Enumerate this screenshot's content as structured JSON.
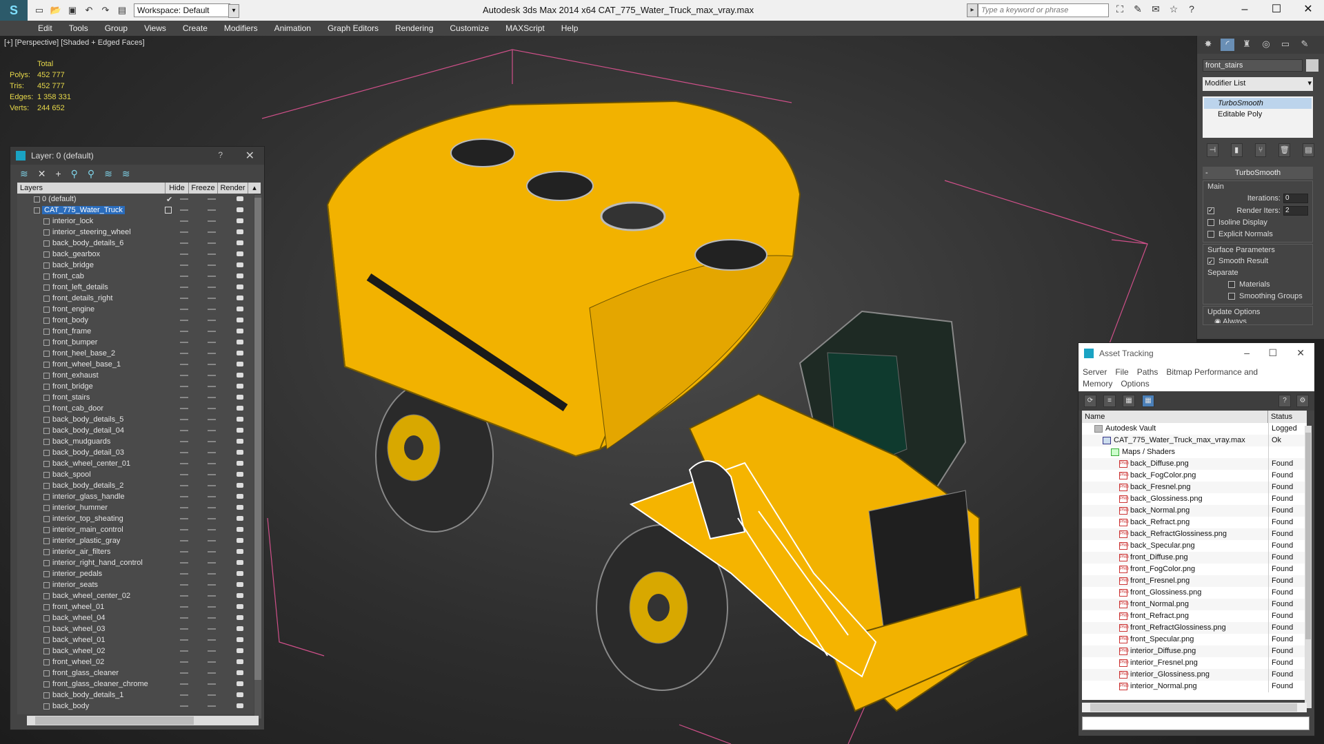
{
  "window": {
    "title": "Autodesk 3ds Max 2014 x64      CAT_775_Water_Truck_max_vray.max",
    "workspace": "Workspace: Default",
    "search_placeholder": "Type a keyword or phrase"
  },
  "menu": [
    "Edit",
    "Tools",
    "Group",
    "Views",
    "Create",
    "Modifiers",
    "Animation",
    "Graph Editors",
    "Rendering",
    "Customize",
    "MAXScript",
    "Help"
  ],
  "viewport": {
    "label": "[+] [Perspective] [Shaded + Edged Faces]",
    "stats": {
      "header": "Total",
      "rows": [
        {
          "k": "Polys:",
          "v": "452 777"
        },
        {
          "k": "Tris:",
          "v": "452 777"
        },
        {
          "k": "Edges:",
          "v": "1 358 331"
        },
        {
          "k": "Verts:",
          "v": "244 652"
        }
      ]
    },
    "accent_color": "#f5b400"
  },
  "layer_panel": {
    "title": "Layer: 0 (default)",
    "help": "?",
    "columns": [
      "Layers",
      "Hide",
      "Freeze",
      "Render"
    ],
    "layers": [
      {
        "name": "0 (default)",
        "level": 0,
        "checked": true
      },
      {
        "name": "CAT_775_Water_Truck",
        "level": 0,
        "selected": true
      },
      {
        "name": "interior_lock",
        "level": 1
      },
      {
        "name": "interior_steering_wheel",
        "level": 1
      },
      {
        "name": "back_body_details_6",
        "level": 1
      },
      {
        "name": "back_gearbox",
        "level": 1
      },
      {
        "name": "back_bridge",
        "level": 1
      },
      {
        "name": "front_cab",
        "level": 1
      },
      {
        "name": "front_left_details",
        "level": 1
      },
      {
        "name": "front_details_right",
        "level": 1
      },
      {
        "name": "front_engine",
        "level": 1
      },
      {
        "name": "front_body",
        "level": 1
      },
      {
        "name": "front_frame",
        "level": 1
      },
      {
        "name": "front_bumper",
        "level": 1
      },
      {
        "name": "front_heel_base_2",
        "level": 1
      },
      {
        "name": "front_wheel_base_1",
        "level": 1
      },
      {
        "name": "front_exhaust",
        "level": 1
      },
      {
        "name": "front_bridge",
        "level": 1
      },
      {
        "name": "front_stairs",
        "level": 1
      },
      {
        "name": "front_cab_door",
        "level": 1
      },
      {
        "name": "back_body_details_5",
        "level": 1
      },
      {
        "name": "back_body_detail_04",
        "level": 1
      },
      {
        "name": "back_mudguards",
        "level": 1
      },
      {
        "name": "back_body_detail_03",
        "level": 1
      },
      {
        "name": "back_wheel_center_01",
        "level": 1
      },
      {
        "name": "back_spool",
        "level": 1
      },
      {
        "name": "back_body_details_2",
        "level": 1
      },
      {
        "name": "interior_glass_handle",
        "level": 1
      },
      {
        "name": "interior_hummer",
        "level": 1
      },
      {
        "name": "interior_top_sheating",
        "level": 1
      },
      {
        "name": "interior_main_control",
        "level": 1
      },
      {
        "name": "interior_plastic_gray",
        "level": 1
      },
      {
        "name": "interior_air_filters",
        "level": 1
      },
      {
        "name": "interior_right_hand_control",
        "level": 1
      },
      {
        "name": "interior_pedals",
        "level": 1
      },
      {
        "name": "interior_seats",
        "level": 1
      },
      {
        "name": "back_wheel_center_02",
        "level": 1
      },
      {
        "name": "front_wheel_01",
        "level": 1
      },
      {
        "name": "back_wheel_04",
        "level": 1
      },
      {
        "name": "back_wheel_03",
        "level": 1
      },
      {
        "name": "back_wheel_01",
        "level": 1
      },
      {
        "name": "back_wheel_02",
        "level": 1
      },
      {
        "name": "front_wheel_02",
        "level": 1
      },
      {
        "name": "front_glass_cleaner",
        "level": 1
      },
      {
        "name": "front_glass_cleaner_chrome",
        "level": 1
      },
      {
        "name": "back_body_details_1",
        "level": 1
      },
      {
        "name": "back_body",
        "level": 1
      }
    ]
  },
  "command_panel": {
    "object_name": "front_stairs",
    "modifier_list": "Modifier List",
    "stack": [
      "TurboSmooth",
      "Editable Poly"
    ],
    "rollout": "TurboSmooth",
    "main_label": "Main",
    "iterations_label": "Iterations:",
    "iterations": "0",
    "render_iters_label": "Render Iters:",
    "render_iters": "2",
    "isoline": "Isoline Display",
    "explicit": "Explicit Normals",
    "surface_label": "Surface Parameters",
    "smooth_result": "Smooth Result",
    "separate_label": "Separate",
    "materials": "Materials",
    "smoothing_groups": "Smoothing Groups",
    "update_label": "Update Options",
    "always": "Always"
  },
  "asset_tracking": {
    "title": "Asset Tracking",
    "menu": [
      "Server",
      "File",
      "Paths",
      "Bitmap Performance and Memory",
      "Options"
    ],
    "columns": [
      "Name",
      "Status"
    ],
    "rows": [
      {
        "name": "Autodesk Vault",
        "status": "Logged",
        "level": 0,
        "kind": "vault"
      },
      {
        "name": "CAT_775_Water_Truck_max_vray.max",
        "status": "Ok",
        "level": 1,
        "kind": "file"
      },
      {
        "name": "Maps / Shaders",
        "status": "",
        "level": 2,
        "kind": "map"
      },
      {
        "name": "back_Diffuse.png",
        "status": "Found",
        "level": 3,
        "kind": "png"
      },
      {
        "name": "back_FogColor.png",
        "status": "Found",
        "level": 3,
        "kind": "png"
      },
      {
        "name": "back_Fresnel.png",
        "status": "Found",
        "level": 3,
        "kind": "png"
      },
      {
        "name": "back_Glossiness.png",
        "status": "Found",
        "level": 3,
        "kind": "png"
      },
      {
        "name": "back_Normal.png",
        "status": "Found",
        "level": 3,
        "kind": "png"
      },
      {
        "name": "back_Refract.png",
        "status": "Found",
        "level": 3,
        "kind": "png"
      },
      {
        "name": "back_RefractGlossiness.png",
        "status": "Found",
        "level": 3,
        "kind": "png"
      },
      {
        "name": "back_Specular.png",
        "status": "Found",
        "level": 3,
        "kind": "png"
      },
      {
        "name": "front_Diffuse.png",
        "status": "Found",
        "level": 3,
        "kind": "png"
      },
      {
        "name": "front_FogColor.png",
        "status": "Found",
        "level": 3,
        "kind": "png"
      },
      {
        "name": "front_Fresnel.png",
        "status": "Found",
        "level": 3,
        "kind": "png"
      },
      {
        "name": "front_Glossiness.png",
        "status": "Found",
        "level": 3,
        "kind": "png"
      },
      {
        "name": "front_Normal.png",
        "status": "Found",
        "level": 3,
        "kind": "png"
      },
      {
        "name": "front_Refract.png",
        "status": "Found",
        "level": 3,
        "kind": "png"
      },
      {
        "name": "front_RefractGlossiness.png",
        "status": "Found",
        "level": 3,
        "kind": "png"
      },
      {
        "name": "front_Specular.png",
        "status": "Found",
        "level": 3,
        "kind": "png"
      },
      {
        "name": "interior_Diffuse.png",
        "status": "Found",
        "level": 3,
        "kind": "png"
      },
      {
        "name": "interior_Fresnel.png",
        "status": "Found",
        "level": 3,
        "kind": "png"
      },
      {
        "name": "interior_Glossiness.png",
        "status": "Found",
        "level": 3,
        "kind": "png"
      },
      {
        "name": "interior_Normal.png",
        "status": "Found",
        "level": 3,
        "kind": "png"
      }
    ]
  }
}
